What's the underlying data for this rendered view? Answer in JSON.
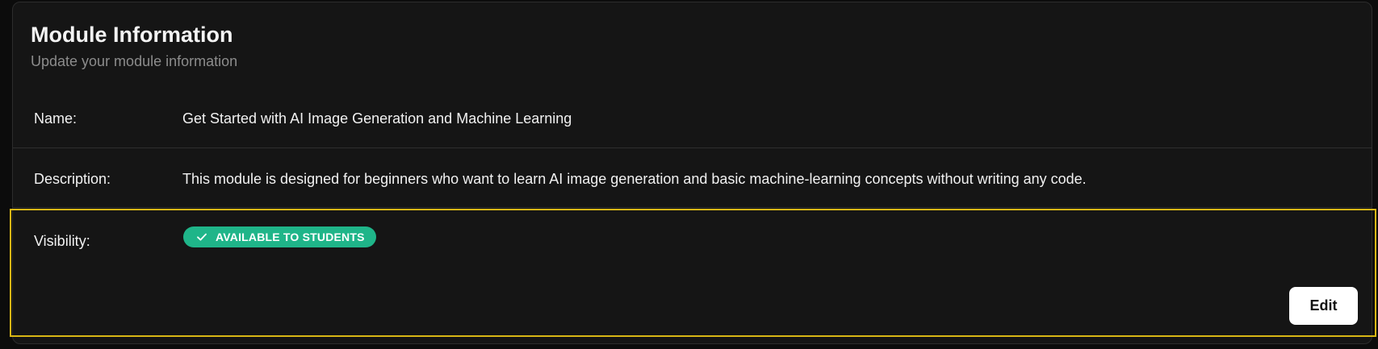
{
  "card": {
    "title": "Module Information",
    "subtitle": "Update your module information"
  },
  "fields": {
    "name": {
      "label": "Name:",
      "value": "Get Started with AI Image Generation and Machine Learning"
    },
    "description": {
      "label": "Description:",
      "value": "This module is designed for beginners who want to learn AI image generation and basic machine-learning concepts without writing any code."
    },
    "visibility": {
      "label": "Visibility:",
      "badge_text": "AVAILABLE TO STUDENTS",
      "badge_icon": "check-icon",
      "badge_color": "#1fb589"
    }
  },
  "actions": {
    "edit_label": "Edit"
  },
  "colors": {
    "background": "#0c0c0c",
    "card": "#151515",
    "highlight_border": "#d8b615"
  }
}
